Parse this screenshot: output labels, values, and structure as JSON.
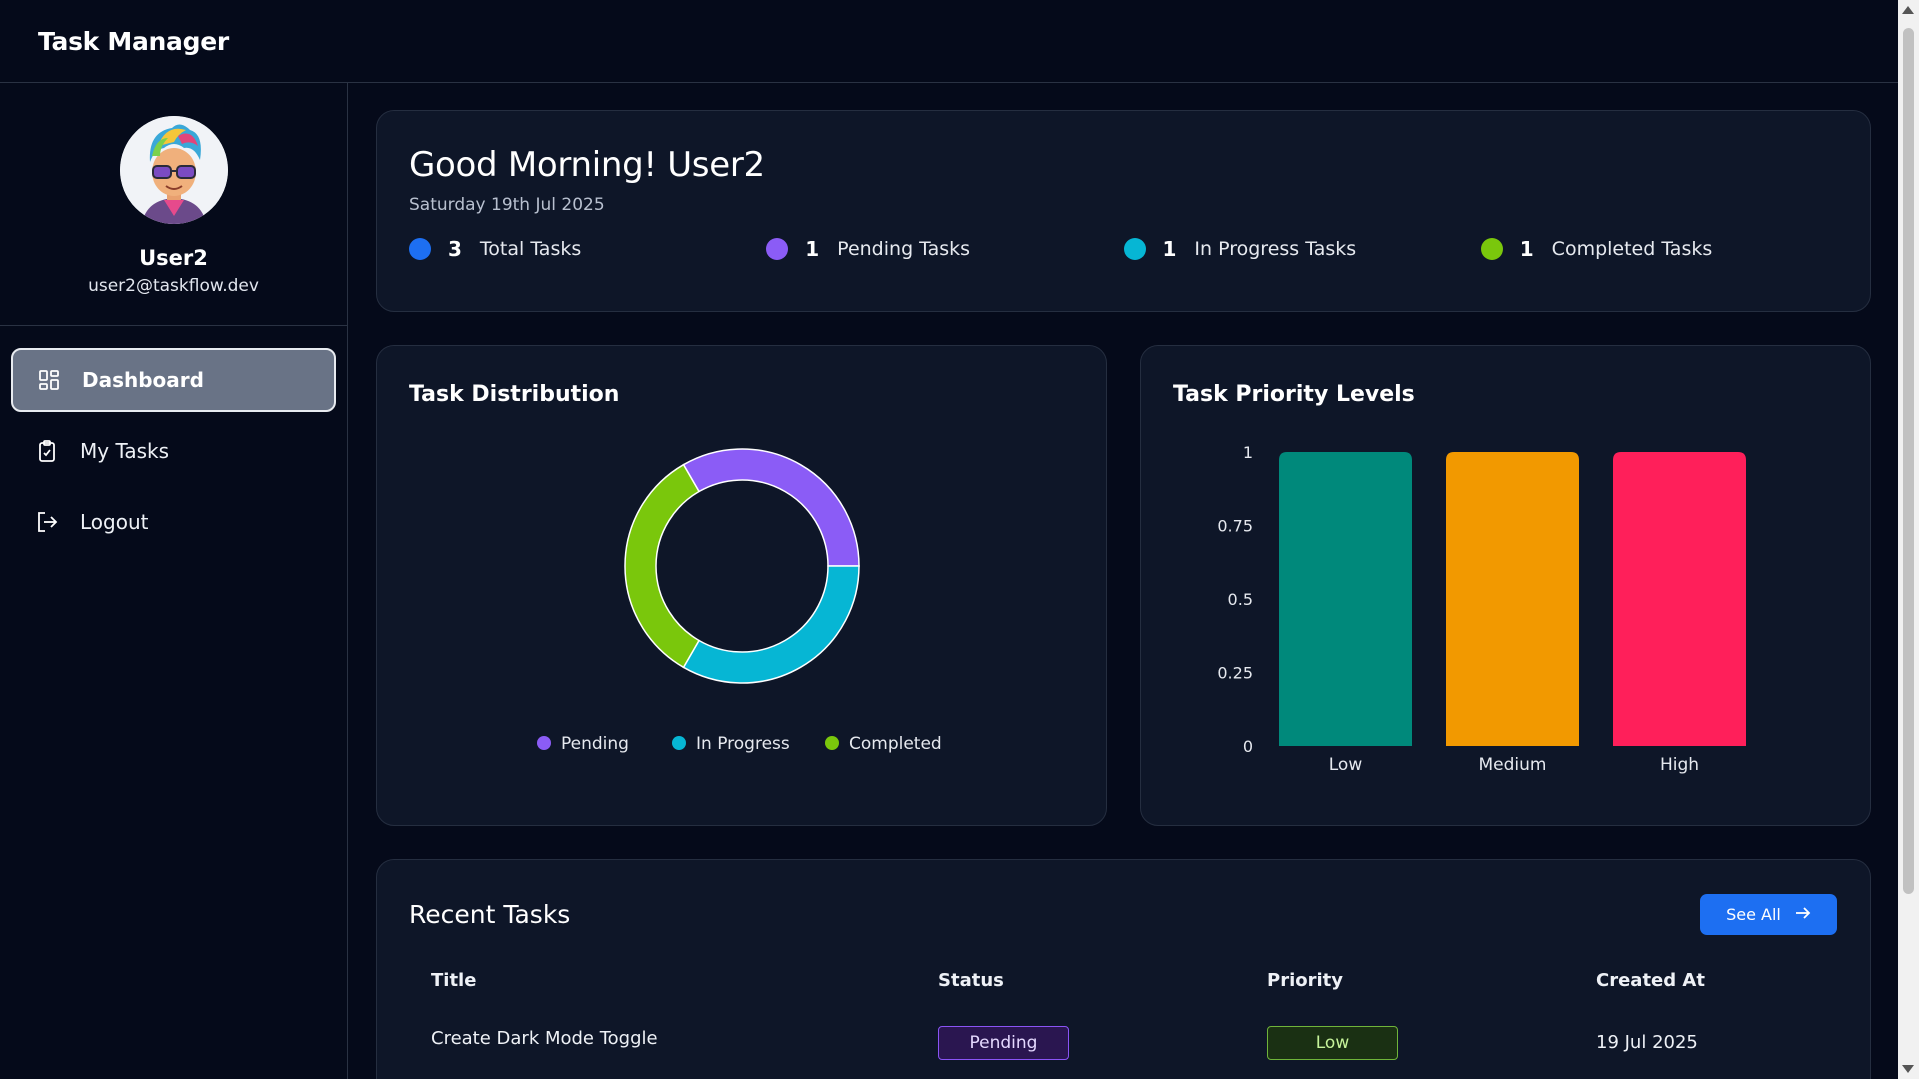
{
  "app": {
    "title": "Task Manager"
  },
  "user": {
    "name": "User2",
    "email": "user2@taskflow.dev"
  },
  "nav": [
    {
      "label": "Dashboard",
      "icon": "dashboard-icon",
      "active": true
    },
    {
      "label": "My Tasks",
      "icon": "clipboard-icon",
      "active": false
    },
    {
      "label": "Logout",
      "icon": "logout-icon",
      "active": false
    }
  ],
  "greeting": {
    "title": "Good Morning! User2",
    "date": "Saturday 19th Jul 2025"
  },
  "stats": [
    {
      "value": "3",
      "label": "Total Tasks",
      "color": "#1d6ff2"
    },
    {
      "value": "1",
      "label": "Pending Tasks",
      "color": "#8b5cf6"
    },
    {
      "value": "1",
      "label": "In Progress Tasks",
      "color": "#06b6d4"
    },
    {
      "value": "1",
      "label": "Completed Tasks",
      "color": "#7ac70c"
    }
  ],
  "distribution": {
    "title": "Task Distribution",
    "chart_data": {
      "type": "pie",
      "categories": [
        "Pending",
        "In Progress",
        "Completed"
      ],
      "values": [
        1,
        1,
        1
      ],
      "colors": [
        "#8b5cf6",
        "#06b6d4",
        "#7ac70c"
      ],
      "legend": "bottom"
    }
  },
  "priority": {
    "title": "Task Priority Levels",
    "chart_data": {
      "type": "bar",
      "categories": [
        "Low",
        "Medium",
        "High"
      ],
      "values": [
        1,
        1,
        1
      ],
      "colors": [
        "#00897b",
        "#f29900",
        "#ff1f5a"
      ],
      "ylim": [
        0,
        1
      ],
      "yticks": [
        "0",
        "0.25",
        "0.5",
        "0.75",
        "1"
      ],
      "grid": false
    }
  },
  "recent": {
    "title": "Recent Tasks",
    "see_all": "See All",
    "columns": [
      "Title",
      "Status",
      "Priority",
      "Created At"
    ],
    "rows": [
      {
        "title": "Create Dark Mode Toggle",
        "status": "Pending",
        "priority": "Low",
        "created": "19 Jul 2025"
      }
    ]
  }
}
